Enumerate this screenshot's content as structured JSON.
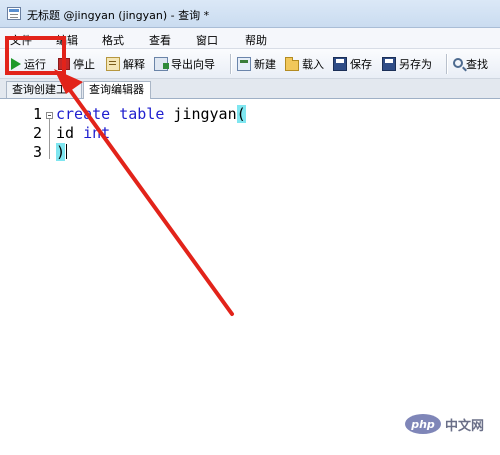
{
  "window": {
    "title": "无标题 @jingyan (jingyan) - 查询 *"
  },
  "menu": [
    {
      "id": "file",
      "label": "文件"
    },
    {
      "id": "edit",
      "label": "编辑"
    },
    {
      "id": "format",
      "label": "格式"
    },
    {
      "id": "view",
      "label": "查看"
    },
    {
      "id": "window",
      "label": "窗口"
    },
    {
      "id": "help",
      "label": "帮助"
    }
  ],
  "toolbar": {
    "run": "运行",
    "stop": "停止",
    "explain": "解释",
    "export_wizard": "导出向导",
    "new": "新建",
    "load": "载入",
    "save": "保存",
    "save_as": "另存为",
    "find": "查找"
  },
  "tabs": [
    {
      "id": "query-builder",
      "label": "查询创建工具",
      "active": false
    },
    {
      "id": "query-editor",
      "label": "查询编辑器",
      "active": true
    }
  ],
  "editor": {
    "line_numbers": [
      "1",
      "2",
      "3"
    ],
    "lines": [
      {
        "kw1": "create",
        "kw2": "table",
        "ident": "jingyan",
        "paren": "("
      },
      {
        "ident": "id",
        "kw": "int"
      },
      {
        "paren": ")"
      }
    ]
  },
  "colors": {
    "annotation": "#e2231a",
    "keyword": "#1f1fcf",
    "bracket_highlight": "#7fe6f0",
    "run_icon": "#1f9a2a",
    "stop_icon": "#c62828"
  },
  "watermark": {
    "logo": "php",
    "text": "中文网"
  }
}
